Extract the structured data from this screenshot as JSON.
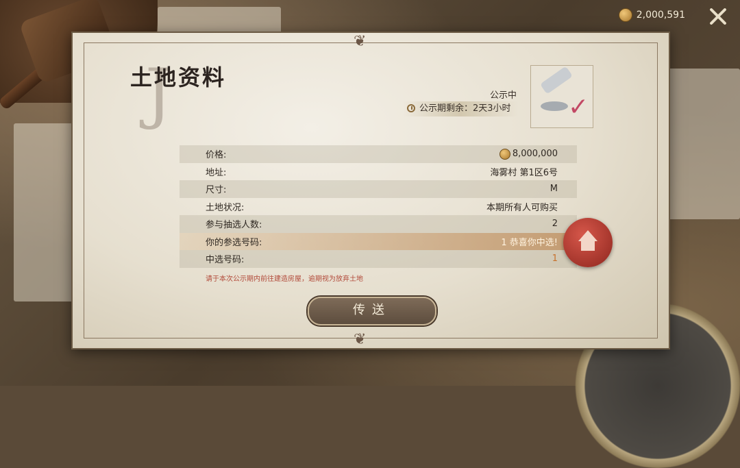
{
  "currency": {
    "amount": "2,000,591",
    "icon": "coin-icon"
  },
  "header": {
    "title": "土地资料",
    "status": "公示中",
    "timer_label": "公示期剩余：2天3小时"
  },
  "details": [
    {
      "label": "价格:",
      "value": "8,000,000"
    },
    {
      "label": "地址:",
      "value": "海雾村 第1区6号"
    },
    {
      "label": "尺寸:",
      "value": "M"
    },
    {
      "label": "土地状况:",
      "value": "本期所有人可购买"
    },
    {
      "label": "参与抽选人数:",
      "value": "2"
    },
    {
      "label": "你的参选号码:",
      "value": "1 恭喜你中选!"
    },
    {
      "label": "中选号码:",
      "value": "1"
    }
  ],
  "note": "请于本次公示期内前往建造房屋，逾期视为放弃土地",
  "actions": {
    "teleport_label": "传送"
  },
  "colors": {
    "highlight": "#c7702a",
    "note": "#b24a3a",
    "seal": "#a8352a"
  }
}
